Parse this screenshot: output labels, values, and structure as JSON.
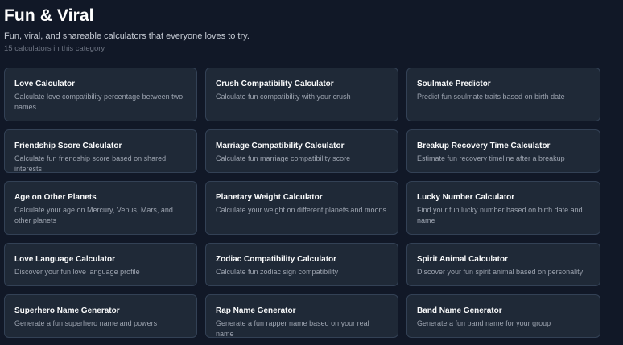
{
  "header": {
    "title": "Fun & Viral",
    "subtitle": "Fun, viral, and shareable calculators that everyone loves to try.",
    "count": "15 calculators in this category"
  },
  "calculators": [
    {
      "title": "Love Calculator",
      "description": "Calculate love compatibility percentage between two names"
    },
    {
      "title": "Crush Compatibility Calculator",
      "description": "Calculate fun compatibility with your crush"
    },
    {
      "title": "Soulmate Predictor",
      "description": "Predict fun soulmate traits based on birth date"
    },
    {
      "title": "Friendship Score Calculator",
      "description": "Calculate fun friendship score based on shared interests"
    },
    {
      "title": "Marriage Compatibility Calculator",
      "description": "Calculate fun marriage compatibility score"
    },
    {
      "title": "Breakup Recovery Time Calculator",
      "description": "Estimate fun recovery timeline after a breakup"
    },
    {
      "title": "Age on Other Planets",
      "description": "Calculate your age on Mercury, Venus, Mars, and other planets"
    },
    {
      "title": "Planetary Weight Calculator",
      "description": "Calculate your weight on different planets and moons"
    },
    {
      "title": "Lucky Number Calculator",
      "description": "Find your fun lucky number based on birth date and name"
    },
    {
      "title": "Love Language Calculator",
      "description": "Discover your fun love language profile"
    },
    {
      "title": "Zodiac Compatibility Calculator",
      "description": "Calculate fun zodiac sign compatibility"
    },
    {
      "title": "Spirit Animal Calculator",
      "description": "Discover your fun spirit animal based on personality"
    },
    {
      "title": "Superhero Name Generator",
      "description": "Generate a fun superhero name and powers"
    },
    {
      "title": "Rap Name Generator",
      "description": "Generate a fun rapper name based on your real name"
    },
    {
      "title": "Band Name Generator",
      "description": "Generate a fun band name for your group"
    }
  ]
}
